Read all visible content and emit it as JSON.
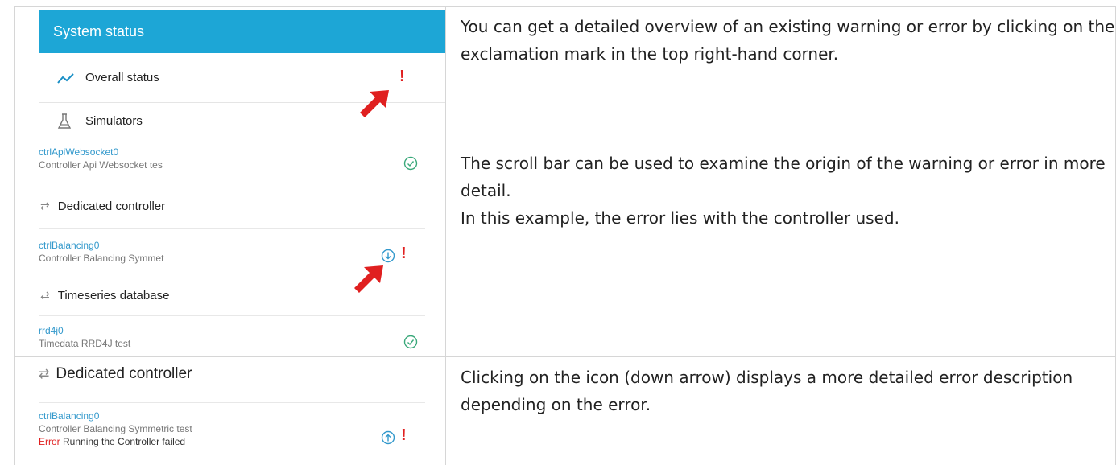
{
  "row1": {
    "header": "System status",
    "items": [
      {
        "label": "Overall status",
        "icon": "trend-line-icon"
      },
      {
        "label": "Simulators",
        "icon": "flask-icon"
      }
    ],
    "marker": "!",
    "text": "You can get a detailed overview of an existing warning or error by clicking on the exclamation mark in the top right-hand corner."
  },
  "row2": {
    "components": [
      {
        "id": "ctrlApiWebsocket0",
        "desc": "Controller Api Websocket tes"
      },
      {
        "id": "ctrlBalancing0",
        "desc": "Controller Balancing Symmet"
      },
      {
        "id": "rrd4j0",
        "desc": "Timedata RRD4J test"
      }
    ],
    "groups": [
      "Dedicated controller",
      "Timeseries database"
    ],
    "marker": "!",
    "text1": "The scroll bar can be used to examine the origin of the warning or error in more detail.",
    "text2": "In this example, the error lies with the controller used."
  },
  "row3": {
    "group": "Dedicated controller",
    "component_id": "ctrlBalancing0",
    "component_desc": "Controller Balancing Symmetric test",
    "error_label": "Error",
    "error_text": " Running the Controller failed",
    "marker": "!",
    "text": "Clicking on the icon (down arrow) displays a more detailed error description depending on the error."
  },
  "colors": {
    "header": "#1da6d6",
    "accent": "#3399cc",
    "ok": "#3aa87a",
    "error": "#e02020",
    "arrow": "#e02020"
  }
}
